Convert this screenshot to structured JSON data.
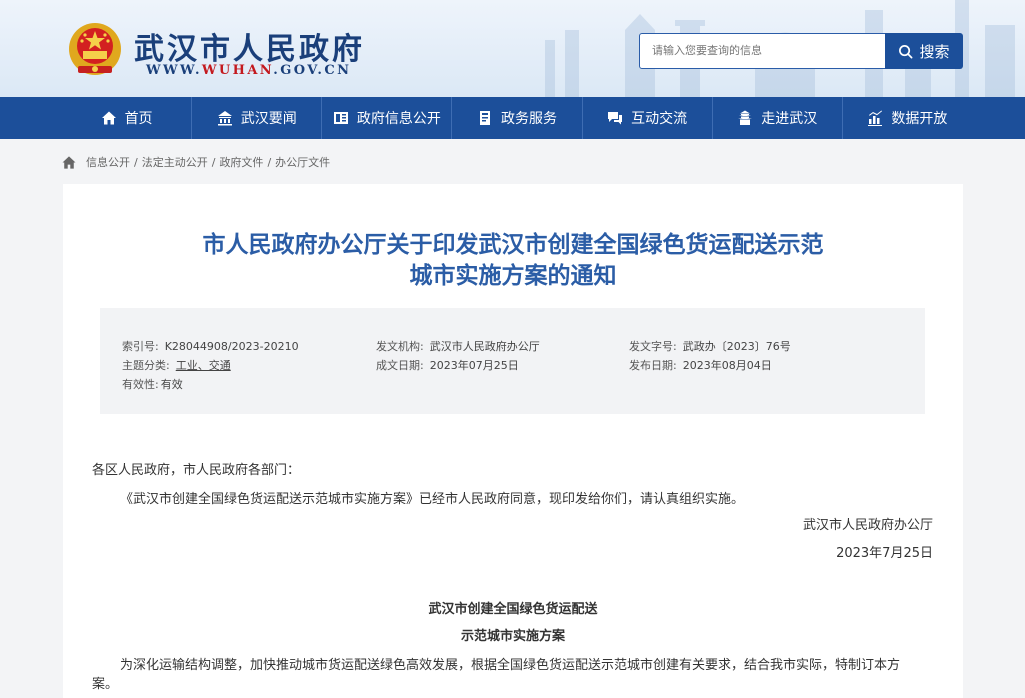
{
  "header": {
    "site_title": "武汉市人民政府",
    "url_prefix": "WWW.",
    "url_red": "WUHAN",
    "url_suffix": ".GOV.CN",
    "search_placeholder": "请输入您要查询的信息",
    "search_button": "搜索",
    "search_icon": "search-icon"
  },
  "nav": {
    "items": [
      {
        "label": "首页",
        "icon": "home-icon"
      },
      {
        "label": "武汉要闻",
        "icon": "news-icon"
      },
      {
        "label": "政府信息公开",
        "icon": "info-disclosure-icon"
      },
      {
        "label": "政务服务",
        "icon": "service-icon"
      },
      {
        "label": "互动交流",
        "icon": "interaction-icon"
      },
      {
        "label": "走进武汉",
        "icon": "city-icon"
      },
      {
        "label": "数据开放",
        "icon": "data-chart-icon"
      }
    ]
  },
  "breadcrumb": {
    "icon": "home-icon",
    "items": [
      "信息公开",
      "法定主动公开",
      "政府文件",
      "办公厅文件"
    ],
    "separator": "/"
  },
  "document": {
    "title_line1": "市人民政府办公厅关于印发武汉市创建全国绿色货运配送示范",
    "title_line2": "城市实施方案的通知",
    "meta": {
      "index_label": "索引号:",
      "index_value": "K28044908/2023-20210",
      "issuer_label": "发文机构:",
      "issuer_value": "武汉市人民政府办公厅",
      "doc_no_label": "发文字号:",
      "doc_no_value": "武政办〔2023〕76号",
      "topic_label": "主题分类:",
      "topic_value": "工业、交通",
      "date_label": "成文日期:",
      "date_value": "2023年07月25日",
      "publish_label": "发布日期:",
      "publish_value": "2023年08月04日",
      "validity_label": "有效性:",
      "validity_value": "有效"
    },
    "salutation": "各区人民政府，市人民政府各部门：",
    "para1": "《武汉市创建全国绿色货运配送示范城市实施方案》已经市人民政府同意，现印发给你们，请认真组织实施。",
    "signature": "武汉市人民政府办公厅",
    "sign_date": "2023年7月25日",
    "sub_title_line1": "武汉市创建全国绿色货运配送",
    "sub_title_line2": "示范城市实施方案",
    "para2_line1": "为深化运输结构调整，加快推动城市货运配送绿色高效发展，根据全国绿色货运配送示范城市创建有关要求，结合我市实际，特制订本方",
    "para2_line2": "案。"
  },
  "colors": {
    "brand_blue": "#1c4f9a",
    "title_blue": "#2b5da6",
    "url_red": "#c3191e"
  }
}
